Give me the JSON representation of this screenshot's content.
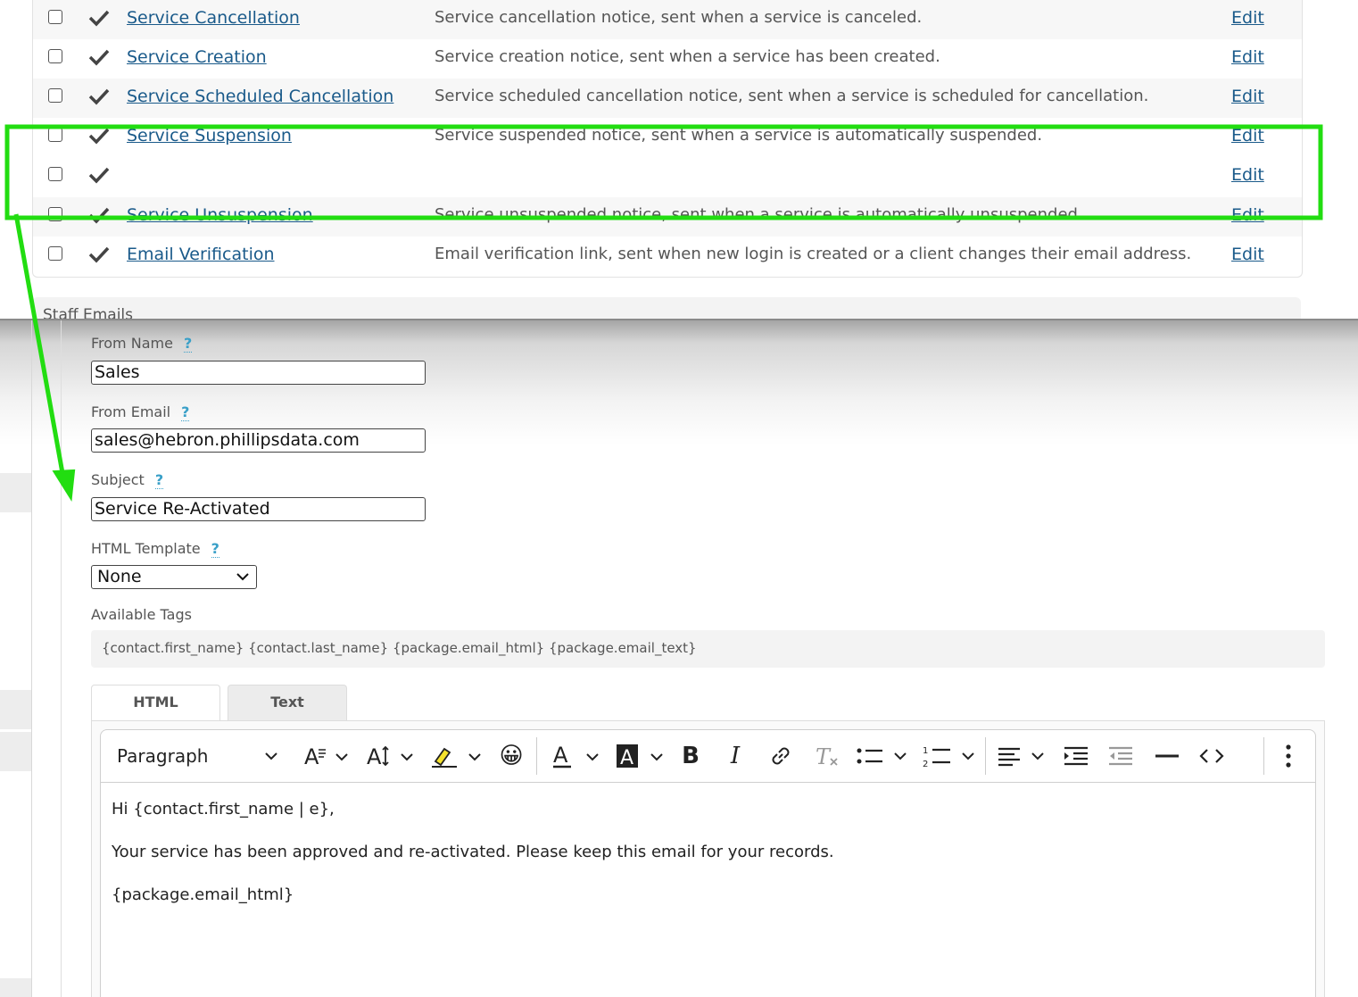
{
  "notices": [
    {
      "name": "Service Cancellation",
      "description": "Service cancellation notice, sent when a service is canceled.",
      "edit": "Edit"
    },
    {
      "name": "Service Creation",
      "description": "Service creation notice, sent when a service has been created.",
      "edit": "Edit"
    },
    {
      "name": "Service Scheduled Cancellation",
      "description": "Service scheduled cancellation notice, sent when a service is scheduled for cancellation.",
      "edit": "Edit"
    },
    {
      "name": "Service Suspension",
      "description": "Service suspended notice, sent when a service is automatically suspended.",
      "edit": "Edit"
    },
    {
      "name": "",
      "description": "",
      "edit": "Edit"
    },
    {
      "name": "Service Unsuspension",
      "description": "Service unsuspended notice, sent when a service is automatically unsuspended.",
      "edit": "Edit"
    },
    {
      "name": "Email Verification",
      "description": "Email verification link, sent when new login is created or a client changes their email address.",
      "edit": "Edit"
    }
  ],
  "staff_section": "Staff Emails",
  "form": {
    "from_name_label": "From Name",
    "from_name_value": "Sales",
    "from_email_label": "From Email",
    "from_email_value": "sales@hebron.phillipsdata.com",
    "subject_label": "Subject",
    "subject_value": "Service Re-Activated",
    "html_template_label": "HTML Template",
    "html_template_value": "None",
    "help": "?",
    "available_tags_label": "Available Tags",
    "available_tags": "{contact.first_name} {contact.last_name} {package.email_html} {package.email_text}"
  },
  "tabs": {
    "html": "HTML",
    "text": "Text"
  },
  "toolbar": {
    "block_format": "Paragraph",
    "emoji": "😀"
  },
  "body": {
    "line1": "Hi {contact.first_name | e},",
    "line2": "Your service has been approved and re-activated. Please keep this email for your records.",
    "line3": "{package.email_html}"
  },
  "annotation": {
    "highlight_color": "#22dd11"
  }
}
